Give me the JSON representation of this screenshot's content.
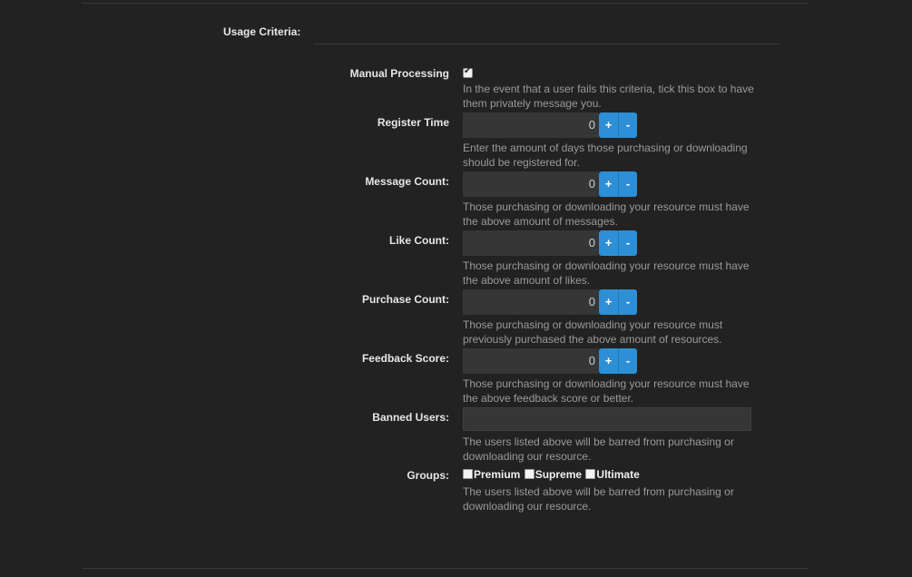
{
  "section": {
    "title": "Usage Criteria:"
  },
  "manual_processing": {
    "label": "Manual Processing",
    "checked": true,
    "hint": "In the event that a user fails this criteria, tick this box to have them privately message you."
  },
  "register_time": {
    "label": "Register Time",
    "value": "0",
    "plus": "+",
    "minus": "-",
    "hint": "Enter the amount of days those purchasing or downloading should be registered for."
  },
  "message_count": {
    "label": "Message Count:",
    "value": "0",
    "plus": "+",
    "minus": "-",
    "hint": "Those purchasing or downloading your resource must have the above amount of messages."
  },
  "like_count": {
    "label": "Like Count:",
    "value": "0",
    "plus": "+",
    "minus": "-",
    "hint": "Those purchasing or downloading your resource must have the above amount of likes."
  },
  "purchase_count": {
    "label": "Purchase Count:",
    "value": "0",
    "plus": "+",
    "minus": "-",
    "hint": "Those purchasing or downloading your resource must previously purchased the above amount of resources."
  },
  "feedback_score": {
    "label": "Feedback Score:",
    "value": "0",
    "plus": "+",
    "minus": "-",
    "hint": "Those purchasing or downloading your resource must have the above feedback score or better."
  },
  "banned_users": {
    "label": "Banned Users:",
    "value": "",
    "hint": "The users listed above will be barred from purchasing or downloading our resource."
  },
  "groups": {
    "label": "Groups:",
    "options": [
      {
        "label": "Premium",
        "checked": false
      },
      {
        "label": "Supreme",
        "checked": false
      },
      {
        "label": "Ultimate",
        "checked": false
      }
    ],
    "hint": "The users listed above will be barred from purchasing or downloading our resource."
  }
}
